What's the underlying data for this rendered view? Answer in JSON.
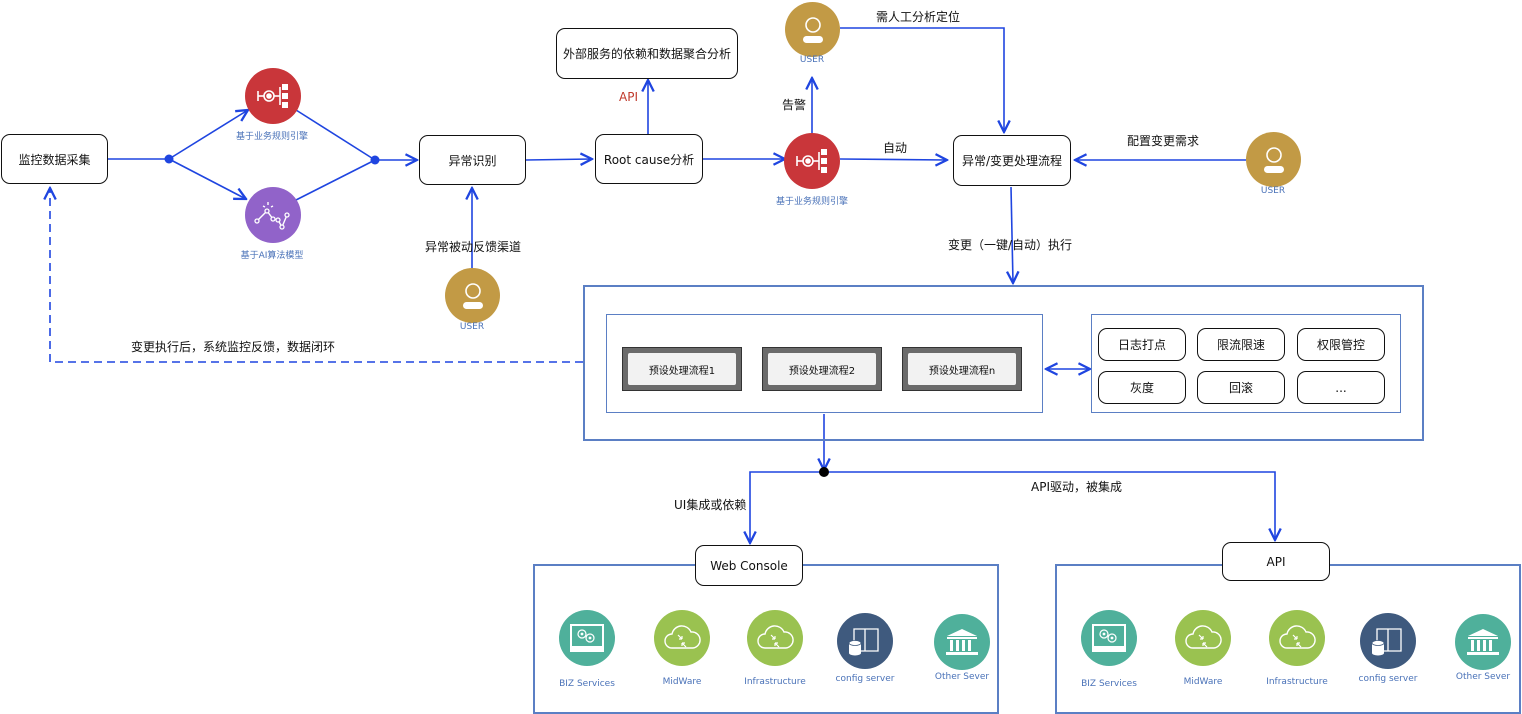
{
  "colors": {
    "wire": "#1f45e0",
    "frame": "#5b7fc4",
    "rule_engine": "#c9363a",
    "ai_model": "#9163c9",
    "user": "#c29a45",
    "biz": "#4fb09b",
    "midware": "#9ac250",
    "config": "#3f5a7e",
    "caption": "#4a72b8",
    "api_label": "#c0392b"
  },
  "nodes": {
    "monitor_collect": "监控数据采集",
    "anomaly_detect": "异常识别",
    "root_cause": "Root cause分析",
    "external_analysis": "外部服务的依赖和数据聚合分析",
    "process_flow": "异常/变更处理流程",
    "web_console": "Web Console",
    "api_box": "API"
  },
  "icons": {
    "rule_engine_1": {
      "icon": "rule-engine-icon",
      "caption": "基于业务规则引擎"
    },
    "ai_model": {
      "icon": "ai-chart-icon",
      "caption": "基于AI算法模型"
    },
    "rule_engine_2": {
      "icon": "rule-engine-icon",
      "caption": "基于业务规则引擎"
    },
    "user_top": {
      "icon": "user-icon",
      "caption": "USER"
    },
    "user_bottom": {
      "icon": "user-icon",
      "caption": "USER"
    },
    "user_right": {
      "icon": "user-icon",
      "caption": "USER"
    }
  },
  "edge_labels": {
    "api": "API",
    "alert": "告警",
    "manual": "需人工分析定位",
    "auto": "自动",
    "config_request": "配置变更需求",
    "passive_feedback": "异常被动反馈渠道",
    "execute": "变更（一键/自动）执行",
    "closed_loop": "变更执行后，系统监控反馈，数据闭环",
    "ui_integration": "UI集成或依赖",
    "api_driven": "API驱动，被集成"
  },
  "presets": [
    "预设处理流程1",
    "预设处理流程2",
    "预设处理流程n"
  ],
  "features": [
    "日志打点",
    "限流限速",
    "权限管控",
    "灰度",
    "回滚",
    "..."
  ],
  "services_left": [
    {
      "icon": "biz-services-icon",
      "label": "BIZ  Services"
    },
    {
      "icon": "midware-cloud-icon",
      "label": "MidWare"
    },
    {
      "icon": "infrastructure-cloud-icon",
      "label": "Infrastructure"
    },
    {
      "icon": "config-server-icon",
      "label": "config server"
    },
    {
      "icon": "other-server-icon",
      "label": "Other Sever"
    }
  ],
  "services_right": [
    {
      "icon": "biz-services-icon",
      "label": "BIZ  Services"
    },
    {
      "icon": "midware-cloud-icon",
      "label": "MidWare"
    },
    {
      "icon": "infrastructure-cloud-icon",
      "label": "Infrastructure"
    },
    {
      "icon": "config-server-icon",
      "label": "config server"
    },
    {
      "icon": "other-server-icon",
      "label": "Other Sever"
    }
  ]
}
